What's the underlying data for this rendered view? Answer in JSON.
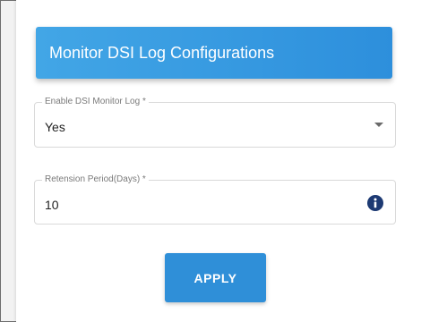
{
  "header": {
    "title": "Monitor DSI Log Configurations"
  },
  "form": {
    "monitor_log": {
      "label": "Enable DSI Monitor Log *",
      "value": "Yes"
    },
    "retention": {
      "label": "Retension Period(Days) *",
      "value": "10",
      "icon": "info-icon"
    },
    "apply_label": "APPLY"
  },
  "colors": {
    "accent": "#2f8fd8",
    "header_gradient_start": "#42a6e6",
    "info_icon": "#1d3a73"
  }
}
